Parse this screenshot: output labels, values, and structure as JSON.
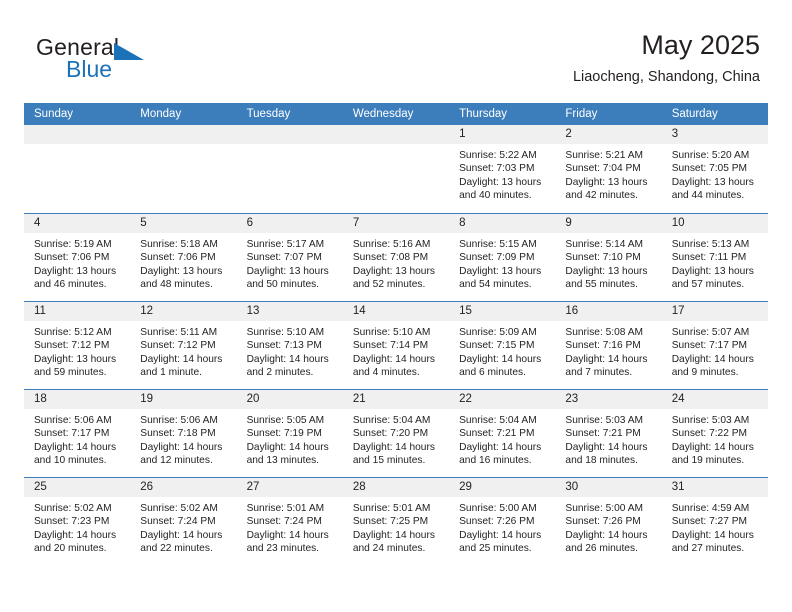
{
  "brand": {
    "name_part1": "General",
    "name_part2": "Blue",
    "flag_icon": "flag-triangle-icon"
  },
  "header": {
    "title": "May 2025",
    "subtitle": "Liaocheng, Shandong, China"
  },
  "colors": {
    "header_blue": "#3c7ebc",
    "brand_blue": "#1b72b8",
    "day_strip_gray": "#f0f0f0",
    "text": "#231f20"
  },
  "calendar": {
    "day_headers": [
      "Sunday",
      "Monday",
      "Tuesday",
      "Wednesday",
      "Thursday",
      "Friday",
      "Saturday"
    ],
    "weeks": [
      [
        {
          "day": "",
          "empty": true,
          "sunrise": "",
          "sunset": "",
          "daylight1": "",
          "daylight2": ""
        },
        {
          "day": "",
          "empty": true,
          "sunrise": "",
          "sunset": "",
          "daylight1": "",
          "daylight2": ""
        },
        {
          "day": "",
          "empty": true,
          "sunrise": "",
          "sunset": "",
          "daylight1": "",
          "daylight2": ""
        },
        {
          "day": "",
          "empty": true,
          "sunrise": "",
          "sunset": "",
          "daylight1": "",
          "daylight2": ""
        },
        {
          "day": "1",
          "sunrise": "Sunrise: 5:22 AM",
          "sunset": "Sunset: 7:03 PM",
          "daylight1": "Daylight: 13 hours",
          "daylight2": "and 40 minutes."
        },
        {
          "day": "2",
          "sunrise": "Sunrise: 5:21 AM",
          "sunset": "Sunset: 7:04 PM",
          "daylight1": "Daylight: 13 hours",
          "daylight2": "and 42 minutes."
        },
        {
          "day": "3",
          "sunrise": "Sunrise: 5:20 AM",
          "sunset": "Sunset: 7:05 PM",
          "daylight1": "Daylight: 13 hours",
          "daylight2": "and 44 minutes."
        }
      ],
      [
        {
          "day": "4",
          "sunrise": "Sunrise: 5:19 AM",
          "sunset": "Sunset: 7:06 PM",
          "daylight1": "Daylight: 13 hours",
          "daylight2": "and 46 minutes."
        },
        {
          "day": "5",
          "sunrise": "Sunrise: 5:18 AM",
          "sunset": "Sunset: 7:06 PM",
          "daylight1": "Daylight: 13 hours",
          "daylight2": "and 48 minutes."
        },
        {
          "day": "6",
          "sunrise": "Sunrise: 5:17 AM",
          "sunset": "Sunset: 7:07 PM",
          "daylight1": "Daylight: 13 hours",
          "daylight2": "and 50 minutes."
        },
        {
          "day": "7",
          "sunrise": "Sunrise: 5:16 AM",
          "sunset": "Sunset: 7:08 PM",
          "daylight1": "Daylight: 13 hours",
          "daylight2": "and 52 minutes."
        },
        {
          "day": "8",
          "sunrise": "Sunrise: 5:15 AM",
          "sunset": "Sunset: 7:09 PM",
          "daylight1": "Daylight: 13 hours",
          "daylight2": "and 54 minutes."
        },
        {
          "day": "9",
          "sunrise": "Sunrise: 5:14 AM",
          "sunset": "Sunset: 7:10 PM",
          "daylight1": "Daylight: 13 hours",
          "daylight2": "and 55 minutes."
        },
        {
          "day": "10",
          "sunrise": "Sunrise: 5:13 AM",
          "sunset": "Sunset: 7:11 PM",
          "daylight1": "Daylight: 13 hours",
          "daylight2": "and 57 minutes."
        }
      ],
      [
        {
          "day": "11",
          "sunrise": "Sunrise: 5:12 AM",
          "sunset": "Sunset: 7:12 PM",
          "daylight1": "Daylight: 13 hours",
          "daylight2": "and 59 minutes."
        },
        {
          "day": "12",
          "sunrise": "Sunrise: 5:11 AM",
          "sunset": "Sunset: 7:12 PM",
          "daylight1": "Daylight: 14 hours",
          "daylight2": "and 1 minute."
        },
        {
          "day": "13",
          "sunrise": "Sunrise: 5:10 AM",
          "sunset": "Sunset: 7:13 PM",
          "daylight1": "Daylight: 14 hours",
          "daylight2": "and 2 minutes."
        },
        {
          "day": "14",
          "sunrise": "Sunrise: 5:10 AM",
          "sunset": "Sunset: 7:14 PM",
          "daylight1": "Daylight: 14 hours",
          "daylight2": "and 4 minutes."
        },
        {
          "day": "15",
          "sunrise": "Sunrise: 5:09 AM",
          "sunset": "Sunset: 7:15 PM",
          "daylight1": "Daylight: 14 hours",
          "daylight2": "and 6 minutes."
        },
        {
          "day": "16",
          "sunrise": "Sunrise: 5:08 AM",
          "sunset": "Sunset: 7:16 PM",
          "daylight1": "Daylight: 14 hours",
          "daylight2": "and 7 minutes."
        },
        {
          "day": "17",
          "sunrise": "Sunrise: 5:07 AM",
          "sunset": "Sunset: 7:17 PM",
          "daylight1": "Daylight: 14 hours",
          "daylight2": "and 9 minutes."
        }
      ],
      [
        {
          "day": "18",
          "sunrise": "Sunrise: 5:06 AM",
          "sunset": "Sunset: 7:17 PM",
          "daylight1": "Daylight: 14 hours",
          "daylight2": "and 10 minutes."
        },
        {
          "day": "19",
          "sunrise": "Sunrise: 5:06 AM",
          "sunset": "Sunset: 7:18 PM",
          "daylight1": "Daylight: 14 hours",
          "daylight2": "and 12 minutes."
        },
        {
          "day": "20",
          "sunrise": "Sunrise: 5:05 AM",
          "sunset": "Sunset: 7:19 PM",
          "daylight1": "Daylight: 14 hours",
          "daylight2": "and 13 minutes."
        },
        {
          "day": "21",
          "sunrise": "Sunrise: 5:04 AM",
          "sunset": "Sunset: 7:20 PM",
          "daylight1": "Daylight: 14 hours",
          "daylight2": "and 15 minutes."
        },
        {
          "day": "22",
          "sunrise": "Sunrise: 5:04 AM",
          "sunset": "Sunset: 7:21 PM",
          "daylight1": "Daylight: 14 hours",
          "daylight2": "and 16 minutes."
        },
        {
          "day": "23",
          "sunrise": "Sunrise: 5:03 AM",
          "sunset": "Sunset: 7:21 PM",
          "daylight1": "Daylight: 14 hours",
          "daylight2": "and 18 minutes."
        },
        {
          "day": "24",
          "sunrise": "Sunrise: 5:03 AM",
          "sunset": "Sunset: 7:22 PM",
          "daylight1": "Daylight: 14 hours",
          "daylight2": "and 19 minutes."
        }
      ],
      [
        {
          "day": "25",
          "sunrise": "Sunrise: 5:02 AM",
          "sunset": "Sunset: 7:23 PM",
          "daylight1": "Daylight: 14 hours",
          "daylight2": "and 20 minutes."
        },
        {
          "day": "26",
          "sunrise": "Sunrise: 5:02 AM",
          "sunset": "Sunset: 7:24 PM",
          "daylight1": "Daylight: 14 hours",
          "daylight2": "and 22 minutes."
        },
        {
          "day": "27",
          "sunrise": "Sunrise: 5:01 AM",
          "sunset": "Sunset: 7:24 PM",
          "daylight1": "Daylight: 14 hours",
          "daylight2": "and 23 minutes."
        },
        {
          "day": "28",
          "sunrise": "Sunrise: 5:01 AM",
          "sunset": "Sunset: 7:25 PM",
          "daylight1": "Daylight: 14 hours",
          "daylight2": "and 24 minutes."
        },
        {
          "day": "29",
          "sunrise": "Sunrise: 5:00 AM",
          "sunset": "Sunset: 7:26 PM",
          "daylight1": "Daylight: 14 hours",
          "daylight2": "and 25 minutes."
        },
        {
          "day": "30",
          "sunrise": "Sunrise: 5:00 AM",
          "sunset": "Sunset: 7:26 PM",
          "daylight1": "Daylight: 14 hours",
          "daylight2": "and 26 minutes."
        },
        {
          "day": "31",
          "sunrise": "Sunrise: 4:59 AM",
          "sunset": "Sunset: 7:27 PM",
          "daylight1": "Daylight: 14 hours",
          "daylight2": "and 27 minutes."
        }
      ]
    ]
  }
}
